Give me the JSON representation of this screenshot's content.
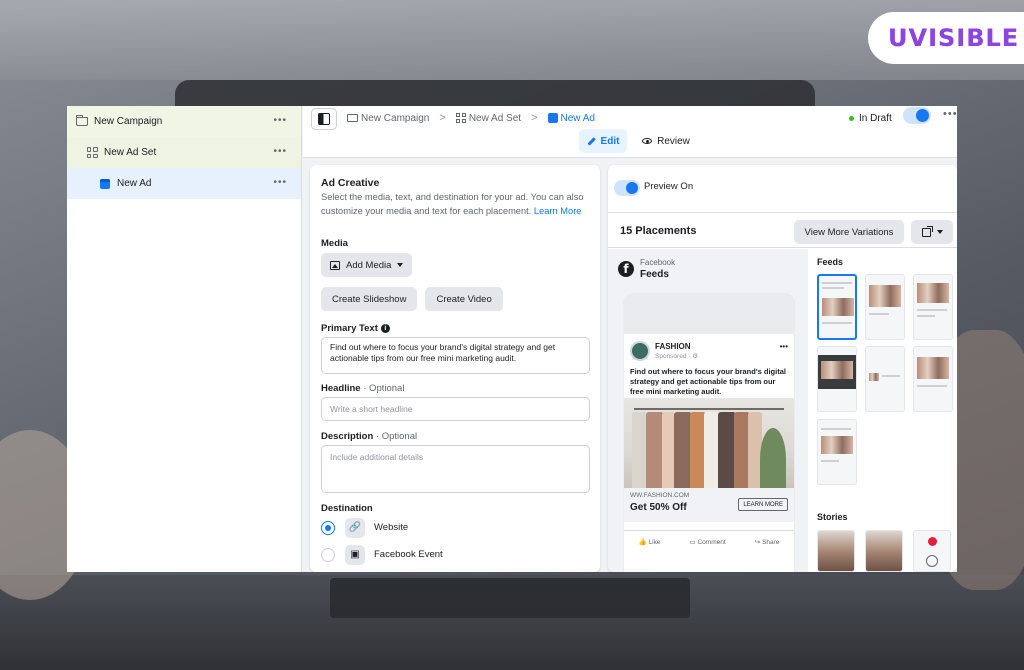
{
  "logo": {
    "text": "UVISIBLE"
  },
  "sidebar": {
    "items": [
      {
        "label": "New Campaign",
        "more": "•••",
        "icon": "folder-icon"
      },
      {
        "label": "New Ad Set",
        "more": "•••",
        "icon": "grid-icon"
      },
      {
        "label": "New Ad",
        "more": "•••",
        "icon": "ad-icon"
      }
    ]
  },
  "topbar": {
    "breadcrumbs": [
      {
        "label": "New Campaign"
      },
      {
        "label": "New Ad Set"
      },
      {
        "label": "New Ad"
      }
    ],
    "separator": ">",
    "status": "In Draft",
    "more": "•••",
    "tabs": {
      "edit": "Edit",
      "review": "Review"
    }
  },
  "creative": {
    "title": "Ad Creative",
    "description": "Select the media, text, and destination for your ad. You can also customize your media and text for each placement.",
    "learn_more": "Learn More",
    "media_label": "Media",
    "add_media": "Add Media",
    "create_slideshow": "Create Slideshow",
    "create_video": "Create Video",
    "primary_text_label": "Primary Text",
    "primary_text_value": "Find out where to focus your brand's digital strategy and get actionable tips from our free mini marketing audit.",
    "headline_label": "Headline",
    "headline_optional": " · Optional",
    "headline_placeholder": "Write a short headline",
    "description_label": "Description",
    "description_optional": " · Optional",
    "description_placeholder": "Include additional details",
    "destination_label": "Destination",
    "destinations": [
      {
        "label": "Website",
        "selected": true
      },
      {
        "label": "Facebook Event",
        "selected": false
      }
    ]
  },
  "preview": {
    "toggle_label": "Preview On",
    "placements_count": "15 Placements",
    "view_more": "View More Variations",
    "source_label": "Facebook",
    "feed_label": "Feeds",
    "post": {
      "brand": "FASHION",
      "sponsored": "Sponsored · ⚙",
      "more": "•••",
      "text": "Find out where to focus your brand's digital strategy and get actionable tips from our free mini marketing audit.",
      "url": "WW.FASHION.COM",
      "offer": "Get 50% Off",
      "cta": "LEARN MORE",
      "actions": [
        "Like",
        "Comment",
        "Share"
      ]
    },
    "sections": {
      "feeds": "Feeds",
      "stories": "Stories"
    }
  },
  "colors": {
    "accent": "#1877f2",
    "draft_dot": "#42b72a",
    "logo_gradient_start": "#7b3fe4",
    "logo_gradient_end": "#c85bd8"
  }
}
